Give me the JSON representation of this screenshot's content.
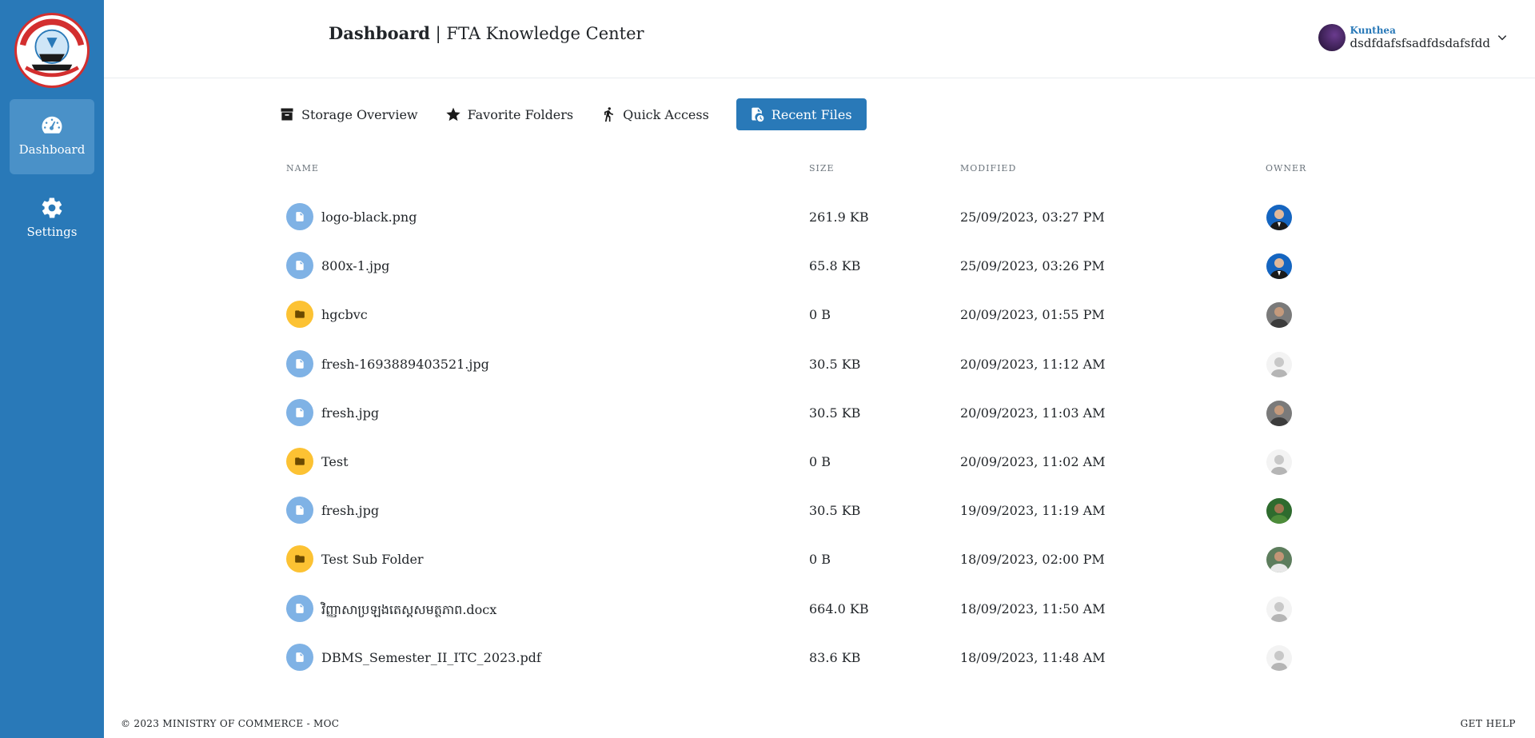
{
  "sidebar": {
    "items": [
      {
        "label": "Dashboard",
        "icon": "speedometer-icon",
        "active": true
      },
      {
        "label": "Settings",
        "icon": "gear-icon",
        "active": false
      }
    ]
  },
  "header": {
    "title_bold": "Dashboard",
    "title_rest": " | FTA Knowledge Center",
    "user": {
      "name": "Kunthea",
      "status": "dsdfdafsfsadfdsdafsfdd"
    }
  },
  "tabs": [
    {
      "label": "Storage Overview",
      "icon": "archive-icon"
    },
    {
      "label": "Favorite Folders",
      "icon": "star-icon"
    },
    {
      "label": "Quick Access",
      "icon": "running-icon"
    },
    {
      "label": "Recent Files",
      "icon": "file-clock-icon",
      "active": true
    }
  ],
  "table": {
    "headers": {
      "name": "NAME",
      "size": "SIZE",
      "modified": "MODIFIED",
      "owner": "OWNER"
    },
    "rows": [
      {
        "name": "logo-black.png",
        "type": "file",
        "size": "261.9 KB",
        "modified": "25/09/2023, 03:27 PM",
        "owner": "suit"
      },
      {
        "name": "800x-1.jpg",
        "type": "file",
        "size": "65.8 KB",
        "modified": "25/09/2023, 03:26 PM",
        "owner": "suit"
      },
      {
        "name": "hgcbvc",
        "type": "folder",
        "size": "0 B",
        "modified": "20/09/2023, 01:55 PM",
        "owner": "photo"
      },
      {
        "name": "fresh-1693889403521.jpg",
        "type": "file",
        "size": "30.5 KB",
        "modified": "20/09/2023, 11:12 AM",
        "owner": "default"
      },
      {
        "name": "fresh.jpg",
        "type": "file",
        "size": "30.5 KB",
        "modified": "20/09/2023, 11:03 AM",
        "owner": "photo"
      },
      {
        "name": "Test",
        "type": "folder",
        "size": "0 B",
        "modified": "20/09/2023, 11:02 AM",
        "owner": "default"
      },
      {
        "name": "fresh.jpg",
        "type": "file",
        "size": "30.5 KB",
        "modified": "19/09/2023, 11:19 AM",
        "owner": "nature"
      },
      {
        "name": "Test Sub Folder",
        "type": "folder",
        "size": "0 B",
        "modified": "18/09/2023, 02:00 PM",
        "owner": "outdoor"
      },
      {
        "name": "វិញ្ញាសាប្រឡងតេស្តសមត្ថភាព.docx",
        "type": "file",
        "size": "664.0 KB",
        "modified": "18/09/2023, 11:50 AM",
        "owner": "default"
      },
      {
        "name": "DBMS_Semester_II_ITC_2023.pdf",
        "type": "file",
        "size": "83.6 KB",
        "modified": "18/09/2023, 11:48 AM",
        "owner": "default"
      }
    ]
  },
  "footer": {
    "left": "© 2023 MINISTRY OF COMMERCE - MOC",
    "right": "GET HELP"
  },
  "colors": {
    "primary": "#2979b8",
    "file_icon": "#7fb2e5",
    "folder_icon": "#fcc233"
  }
}
